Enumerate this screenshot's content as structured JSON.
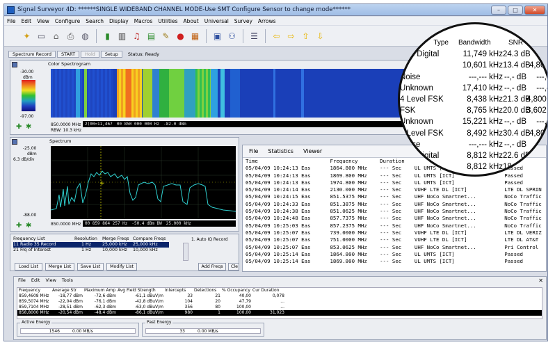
{
  "window": {
    "title": "Signal Surveyor 4D: ******SINGLE WIDEBAND CHANNEL MODE-Use SMT Configure Sensor to change mode******",
    "controls": {
      "minimize": "–",
      "maximize": "□",
      "close": "✕"
    }
  },
  "menubar": [
    "File",
    "Edit",
    "View",
    "Configure",
    "Search",
    "Display",
    "Macros",
    "Utilities",
    "About",
    "Universal",
    "Survey",
    "Arrows"
  ],
  "toolbar_icons": [
    "antenna-icon",
    "monitor-icon",
    "tower-icon",
    "printer-icon",
    "database-icon",
    "bar-meter-icon",
    "record-icon",
    "audio-icon",
    "spectrum-icon",
    "chart-icon",
    "signal-icon",
    "bug-icon",
    "book-icon",
    "grid-icon",
    "people-icon",
    "list-icon",
    "arrow-left-icon",
    "arrow-right-icon",
    "arrow-up-icon",
    "arrow-down-icon"
  ],
  "statusbar": {
    "spectrum_record": "Spectrum Record",
    "start": "START",
    "hold": "Hold",
    "setup": "Setup",
    "status": "Status: Ready"
  },
  "spectrogram": {
    "title": "Color Spectrogram",
    "scale_top": "-30.00",
    "scale_unit": "dBm",
    "scale_bottom": "-97.00",
    "freq_label": "850.0000 MHz",
    "rbw": "RBW: 10.3 kHz",
    "readout": [
      "2(00=11,467",
      "00 850 000 000 Hz",
      "-82.0 dBm"
    ]
  },
  "spectrum": {
    "title": "Spectrum",
    "ref_level": "-25.00",
    "scale_unit": "dBm",
    "div": "6.3 dB/div",
    "bottom_level": "-88.00",
    "freq_label": "850.0000 MHz",
    "readout": [
      "00 859 864 257 Hz",
      "-50.4 dBm BW",
      "25.000 kHz"
    ]
  },
  "frequency_list": {
    "headers": [
      "Frequency List",
      "Resolution",
      "Merge Freqs",
      "Compare Freqs"
    ],
    "rows": [
      [
        "11 Radio 35 Record",
        "1 Hz",
        "25,000 kHz",
        "25,000 kHz"
      ],
      [
        "21 Frq of Interest",
        "1 Hz",
        "10,000 kHz",
        "10,000 kHz"
      ]
    ],
    "auto_iq": "1. Auto IQ Record",
    "buttons": [
      "Load List",
      "Merge List",
      "Save List",
      "Modify List"
    ],
    "add_freqs": "Add Freqs",
    "clear": "Cle"
  },
  "log_window": {
    "menu": [
      "File",
      "Statistics",
      "Viewer"
    ],
    "headers": [
      "Time",
      "Frequency",
      "Duration",
      "",
      "Plan"
    ],
    "rows": [
      [
        "05/04/09 10:24:13 Eas",
        "1864.800 MHz",
        "--- Sec",
        "UL UMTS [ICT]",
        "Passed"
      ],
      [
        "05/04/09 10:24:13 Eas",
        "1869.800 MHz",
        "--- Sec",
        "UL UMTS [ICT]",
        "Passed"
      ],
      [
        "05/04/09 10:24:13 Eas",
        "1974.800 MHz",
        "--- Sec",
        "UL UMTS [ICT]",
        "Passed"
      ],
      [
        "05/04/09 10:24:14 Eas",
        "2130.000 MHz",
        "--- Sec",
        "VUHF LTE DL [ICT]",
        "LTE DL SPRIN"
      ],
      [
        "05/04/09 10:24:15 Eas",
        "851.5375 MHz",
        "--- Sec",
        "UHF NoCo Smartnet...",
        "NoCo Traffic"
      ],
      [
        "05/04/09 10:24:33 Eas",
        "851.3875 MHz",
        "--- Sec",
        "UHF NoCo Smartnet...",
        "NoCo Traffic"
      ],
      [
        "05/04/09 10:24:38 Eas",
        "851.0625 MHz",
        "--- Sec",
        "UHF NoCo Smartnet...",
        "NoCo Traffic"
      ],
      [
        "05/04/09 10:24:48 Eas",
        "857.7375 MHz",
        "--- Sec",
        "UHF NoCo Smartnet...",
        "NoCo Traffic"
      ],
      [
        "05/04/09 10:25:03 Eas",
        "857.2375 MHz",
        "--- Sec",
        "UHF NoCo Smartnet...",
        "NoCo Traffic"
      ],
      [
        "05/04/09 10:25:07 Eas",
        "739.0000 MHz",
        "--- Sec",
        "VUHF LTE DL [ICT]",
        "LTE DL VERIZ"
      ],
      [
        "05/04/09 10:25:07 Eas",
        "751.0000 MHz",
        "--- Sec",
        "VUHF LTE DL [ICT]",
        "LTE DL AT&T"
      ],
      [
        "05/04/09 10:25:07 Eas",
        "853.0625 MHz",
        "--- Sec",
        "UHF NoCo Smartnet...",
        "Pri Control"
      ],
      [
        "05/04/09 10:25:14 Eas",
        "1864.800 MHz",
        "--- Sec",
        "UL UMTS [ICT]",
        "Passed"
      ],
      [
        "05/04/09 10:25:14 Eas",
        "1869.800 MHz",
        "--- Sec",
        "UL UMTS [ICT]",
        "Passed"
      ]
    ]
  },
  "zoom_table": {
    "headers": [
      "Type",
      "Bandwidth",
      "SNR",
      ""
    ],
    "rows": [
      [
        "own Digital",
        "11,749 kHz",
        "24.3 dB",
        "4,..."
      ],
      [
        "K",
        "10,601 kHz",
        "13.4 dB",
        "4,800 Hz"
      ],
      [
        "Noise",
        "---,--- kHz",
        "--,- dB",
        "---,- Hz"
      ],
      [
        "Unknown",
        "17,410 kHz",
        "--,- dB",
        "---,- Hz"
      ],
      [
        "4 Level FSK",
        "8,438 kHz",
        "21.3 dB",
        "4,800 kHz"
      ],
      [
        "FSK",
        "8,765 kHz",
        "20.0 dB",
        "3,602 kHz"
      ],
      [
        "Unknown",
        "15,221 kHz",
        "--,- dB",
        "---,- Hz"
      ],
      [
        "4 Level FSK",
        "8,492 kHz",
        "30.4 dB",
        "4,800 Hz"
      ],
      [
        "Noise",
        "---,--- kHz",
        "--,- dB",
        "---,- Hz"
      ],
      [
        "own Digital",
        "8,812 kHz",
        "22.6 dB",
        "0."
      ],
      [
        "",
        "8,812 kHz",
        "18.1 dB",
        ""
      ]
    ]
  },
  "bottom": {
    "menu": [
      "File",
      "Edit",
      "View",
      "Tools"
    ],
    "headers": [
      "Frequency",
      "Average Str",
      "Maximum Amp",
      "Avg Field Strength",
      "Intercepts",
      "Detections",
      "% Occupancy",
      "Cur Duration"
    ],
    "rows": [
      [
        "859,4608 MHz",
        "-18,77 dBm",
        "-72,6 dBm",
        "-61,1 dBuV/m",
        "33",
        "21",
        "40,00",
        "0,078"
      ],
      [
        "859,5074 MHz",
        "-22,04 dBm",
        "-76,1 dBm",
        "-42,8 dBuV/m",
        "104",
        "20",
        "47,79",
        "..."
      ],
      [
        "859,7104 MHz",
        "-28,51 dBm",
        "-62,3 dBm",
        "-63,0 dBuV/m",
        "356",
        "80",
        "100,00",
        "..."
      ],
      [
        "858,8000 MHz",
        "-20,54 dBm",
        "-48,4 dBm",
        "-86,1 dBuV/m",
        "980",
        "1",
        "100,00",
        "31,023"
      ]
    ],
    "active_energy": {
      "label": "Active Energy",
      "value": "1546",
      "rate": "0.00 MB/s"
    },
    "past_energy": {
      "label": "Past Energy",
      "value": "33",
      "rate": "0.00 MB/s"
    }
  },
  "colors": {
    "trace": "#2fd0d0",
    "selection": "#0a246a",
    "spectrogram_bg": "#1a3fb8"
  }
}
